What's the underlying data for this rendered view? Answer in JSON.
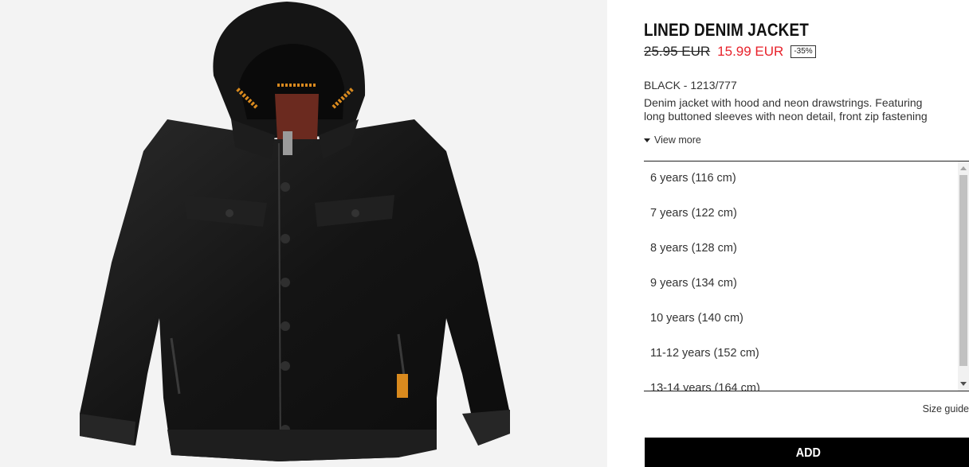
{
  "product": {
    "title": "LINED DENIM JACKET",
    "old_price": "25.95 EUR",
    "new_price": "15.99 EUR",
    "discount": "-35%",
    "color_ref": "BLACK - 1213/777",
    "description_line1": "Denim jacket with hood and neon drawstrings. Featuring",
    "description_line2": "long buttoned sleeves with neon detail, front zip fastening",
    "view_more": "View more"
  },
  "sizes": [
    "6 years (116 cm)",
    "7 years (122 cm)",
    "8 years (128 cm)",
    "9 years (134 cm)",
    "10 years (140 cm)",
    "11-12 years (152 cm)",
    "13-14 years (164 cm)"
  ],
  "size_guide": "Size guide",
  "add_label": "ADD",
  "colors": {
    "sale_red": "#e8222b",
    "button_black": "#000000",
    "image_bg": "#f3f3f3"
  },
  "icons": {
    "view_more": "caret-down-icon",
    "scroll_up": "scroll-up-arrow-icon",
    "scroll_down": "scroll-down-arrow-icon"
  }
}
